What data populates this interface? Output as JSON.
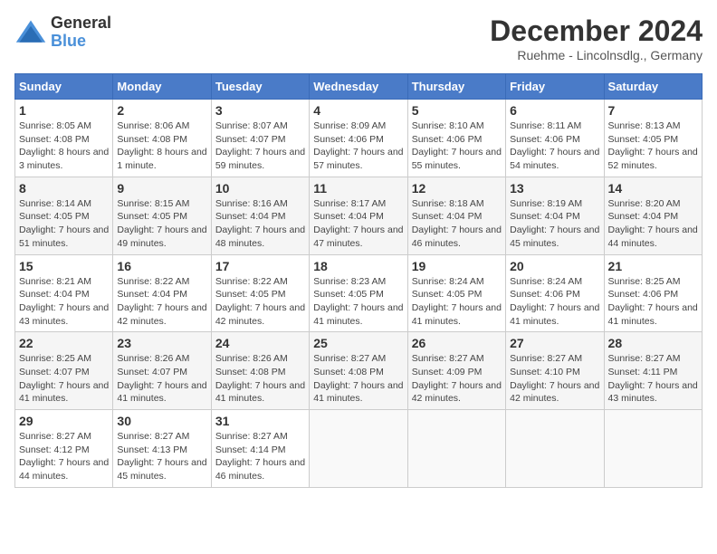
{
  "logo": {
    "general": "General",
    "blue": "Blue"
  },
  "header": {
    "month": "December 2024",
    "subtitle": "Ruehme - Lincolnsdlg., Germany"
  },
  "days_of_week": [
    "Sunday",
    "Monday",
    "Tuesday",
    "Wednesday",
    "Thursday",
    "Friday",
    "Saturday"
  ],
  "weeks": [
    [
      {
        "day": "1",
        "sunrise": "8:05 AM",
        "sunset": "4:08 PM",
        "daylight": "8 hours and 3 minutes."
      },
      {
        "day": "2",
        "sunrise": "8:06 AM",
        "sunset": "4:08 PM",
        "daylight": "8 hours and 1 minute."
      },
      {
        "day": "3",
        "sunrise": "8:07 AM",
        "sunset": "4:07 PM",
        "daylight": "7 hours and 59 minutes."
      },
      {
        "day": "4",
        "sunrise": "8:09 AM",
        "sunset": "4:06 PM",
        "daylight": "7 hours and 57 minutes."
      },
      {
        "day": "5",
        "sunrise": "8:10 AM",
        "sunset": "4:06 PM",
        "daylight": "7 hours and 55 minutes."
      },
      {
        "day": "6",
        "sunrise": "8:11 AM",
        "sunset": "4:06 PM",
        "daylight": "7 hours and 54 minutes."
      },
      {
        "day": "7",
        "sunrise": "8:13 AM",
        "sunset": "4:05 PM",
        "daylight": "7 hours and 52 minutes."
      }
    ],
    [
      {
        "day": "8",
        "sunrise": "8:14 AM",
        "sunset": "4:05 PM",
        "daylight": "7 hours and 51 minutes."
      },
      {
        "day": "9",
        "sunrise": "8:15 AM",
        "sunset": "4:05 PM",
        "daylight": "7 hours and 49 minutes."
      },
      {
        "day": "10",
        "sunrise": "8:16 AM",
        "sunset": "4:04 PM",
        "daylight": "7 hours and 48 minutes."
      },
      {
        "day": "11",
        "sunrise": "8:17 AM",
        "sunset": "4:04 PM",
        "daylight": "7 hours and 47 minutes."
      },
      {
        "day": "12",
        "sunrise": "8:18 AM",
        "sunset": "4:04 PM",
        "daylight": "7 hours and 46 minutes."
      },
      {
        "day": "13",
        "sunrise": "8:19 AM",
        "sunset": "4:04 PM",
        "daylight": "7 hours and 45 minutes."
      },
      {
        "day": "14",
        "sunrise": "8:20 AM",
        "sunset": "4:04 PM",
        "daylight": "7 hours and 44 minutes."
      }
    ],
    [
      {
        "day": "15",
        "sunrise": "8:21 AM",
        "sunset": "4:04 PM",
        "daylight": "7 hours and 43 minutes."
      },
      {
        "day": "16",
        "sunrise": "8:22 AM",
        "sunset": "4:04 PM",
        "daylight": "7 hours and 42 minutes."
      },
      {
        "day": "17",
        "sunrise": "8:22 AM",
        "sunset": "4:05 PM",
        "daylight": "7 hours and 42 minutes."
      },
      {
        "day": "18",
        "sunrise": "8:23 AM",
        "sunset": "4:05 PM",
        "daylight": "7 hours and 41 minutes."
      },
      {
        "day": "19",
        "sunrise": "8:24 AM",
        "sunset": "4:05 PM",
        "daylight": "7 hours and 41 minutes."
      },
      {
        "day": "20",
        "sunrise": "8:24 AM",
        "sunset": "4:06 PM",
        "daylight": "7 hours and 41 minutes."
      },
      {
        "day": "21",
        "sunrise": "8:25 AM",
        "sunset": "4:06 PM",
        "daylight": "7 hours and 41 minutes."
      }
    ],
    [
      {
        "day": "22",
        "sunrise": "8:25 AM",
        "sunset": "4:07 PM",
        "daylight": "7 hours and 41 minutes."
      },
      {
        "day": "23",
        "sunrise": "8:26 AM",
        "sunset": "4:07 PM",
        "daylight": "7 hours and 41 minutes."
      },
      {
        "day": "24",
        "sunrise": "8:26 AM",
        "sunset": "4:08 PM",
        "daylight": "7 hours and 41 minutes."
      },
      {
        "day": "25",
        "sunrise": "8:27 AM",
        "sunset": "4:08 PM",
        "daylight": "7 hours and 41 minutes."
      },
      {
        "day": "26",
        "sunrise": "8:27 AM",
        "sunset": "4:09 PM",
        "daylight": "7 hours and 42 minutes."
      },
      {
        "day": "27",
        "sunrise": "8:27 AM",
        "sunset": "4:10 PM",
        "daylight": "7 hours and 42 minutes."
      },
      {
        "day": "28",
        "sunrise": "8:27 AM",
        "sunset": "4:11 PM",
        "daylight": "7 hours and 43 minutes."
      }
    ],
    [
      {
        "day": "29",
        "sunrise": "8:27 AM",
        "sunset": "4:12 PM",
        "daylight": "7 hours and 44 minutes."
      },
      {
        "day": "30",
        "sunrise": "8:27 AM",
        "sunset": "4:13 PM",
        "daylight": "7 hours and 45 minutes."
      },
      {
        "day": "31",
        "sunrise": "8:27 AM",
        "sunset": "4:14 PM",
        "daylight": "7 hours and 46 minutes."
      },
      null,
      null,
      null,
      null
    ]
  ]
}
